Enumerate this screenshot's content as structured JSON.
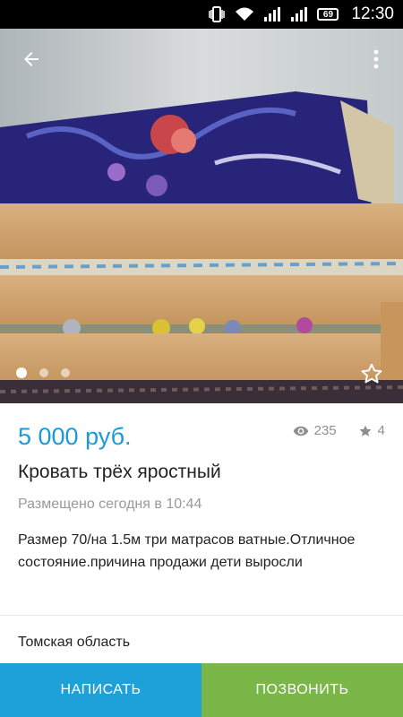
{
  "status_bar": {
    "battery": "69",
    "time": "12:30",
    "icons": [
      "vibrate-icon",
      "wifi-icon",
      "signal-icon",
      "signal-icon",
      "battery-icon"
    ]
  },
  "gallery": {
    "photo_count": 3,
    "active_index": 0
  },
  "listing": {
    "price": "5 000 руб.",
    "views": "235",
    "favorites": "4",
    "title": "Кровать трёх яростный",
    "posted": "Размещено сегодня в 10:44",
    "description": "Размер 70/на 1.5м три матрасов ватные.Отличное состояние.причина продажи дети выросли",
    "region": "Томская область"
  },
  "actions": {
    "write_label": "НАПИСАТЬ",
    "call_label": "ПОЗВОНИТЬ"
  },
  "colors": {
    "accent_blue": "#1ea0d8",
    "accent_green": "#7ab648",
    "price_blue": "#1a9ad6"
  }
}
